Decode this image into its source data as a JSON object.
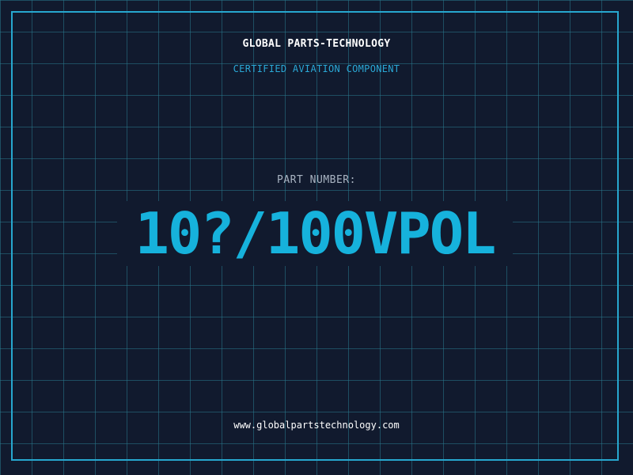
{
  "header": {
    "brand": "GLOBAL PARTS-TECHNOLOGY",
    "subtitle": "CERTIFIED AVIATION COMPONENT"
  },
  "part": {
    "label": "PART NUMBER:",
    "number": "10?/100VPOL"
  },
  "footer": {
    "url": "www.globalpartstechnology.com"
  },
  "colors": {
    "background": "#111a2e",
    "grid": "#28788c",
    "frame": "#27a7cf",
    "accent": "#16b2dc",
    "label": "#a9b4c2"
  }
}
